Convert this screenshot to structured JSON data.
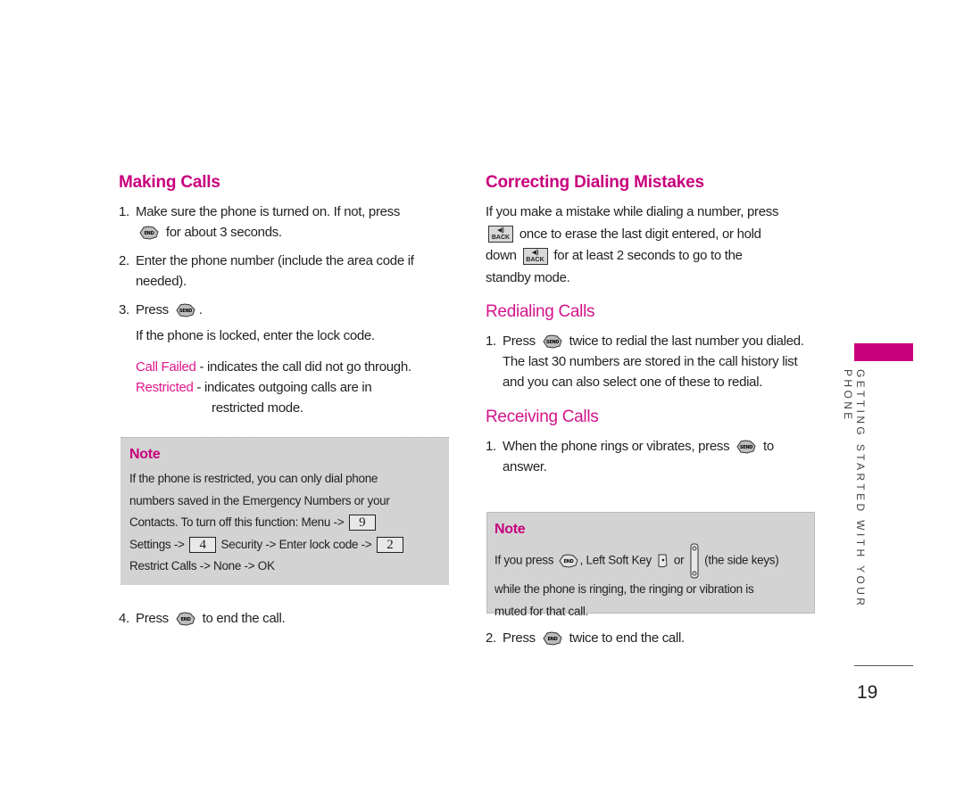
{
  "making_calls": {
    "heading": "Making Calls",
    "steps": [
      {
        "num": "1.",
        "before": "Make sure the phone is turned on. If not, press",
        "icon": "end-key",
        "after": "for about 3 seconds."
      },
      {
        "num": "2.",
        "text": "Enter the phone number (include the area code if needed)."
      },
      {
        "num": "3.",
        "before": "Press",
        "icon": "send-key",
        "after": "."
      },
      {
        "num": "4.",
        "before": "Press",
        "icon": "end-key",
        "after": "to end the call."
      }
    ],
    "locked_text": "If the phone is locked, enter the lock code.",
    "call_failed": {
      "term": "Call Failed",
      "desc": "- indicates the call did not go through."
    },
    "restricted": {
      "term": "Restricted",
      "desc": "- indicates outgoing calls are in",
      "desc2": "restricted mode."
    },
    "note": {
      "title": "Note",
      "line1": "If the phone is restricted, you can only dial phone",
      "line2": "numbers saved in the Emergency Numbers or your",
      "line3": "Contacts. To turn off this function: Menu ->",
      "key9": "9",
      "line4a": "Settings ->",
      "key4": "4",
      "line4b": "Security -> Enter lock code ->",
      "key2": "2",
      "line5": "Restrict Calls -> None -> OK"
    }
  },
  "correcting": {
    "heading": "Correcting Dialing Mistakes",
    "line1": "If you make a mistake while dialing a number, press",
    "line2": "once to erase the last digit entered, or hold",
    "line3a": "down",
    "line3b": "for at least 2 seconds to go to the",
    "line4": "standby mode.",
    "back_key_label": "BACK"
  },
  "redialing": {
    "heading": "Redialing Calls",
    "num": "1.",
    "before": "Press",
    "after": "twice to redial the last number you dialed. The last 30 numbers are stored in the call history list and you can also select one of these to redial."
  },
  "receiving": {
    "heading": "Receiving Calls",
    "step1": {
      "num": "1.",
      "before": "When the phone rings or vibrates, press",
      "after": "to answer."
    },
    "step2": {
      "num": "2.",
      "before": "Press",
      "after": "twice to end the call."
    },
    "note": {
      "title": "Note",
      "a": "If you press",
      "b": ", Left Soft Key",
      "c": "or",
      "d": "(the side keys)",
      "line2": "while the phone is ringing, the ringing or vibration is",
      "line3": "muted for that call."
    }
  },
  "sidebar": {
    "section": "GETTING STARTED WITH YOUR PHONE",
    "accent": "#c8007d"
  },
  "page_number": "19"
}
